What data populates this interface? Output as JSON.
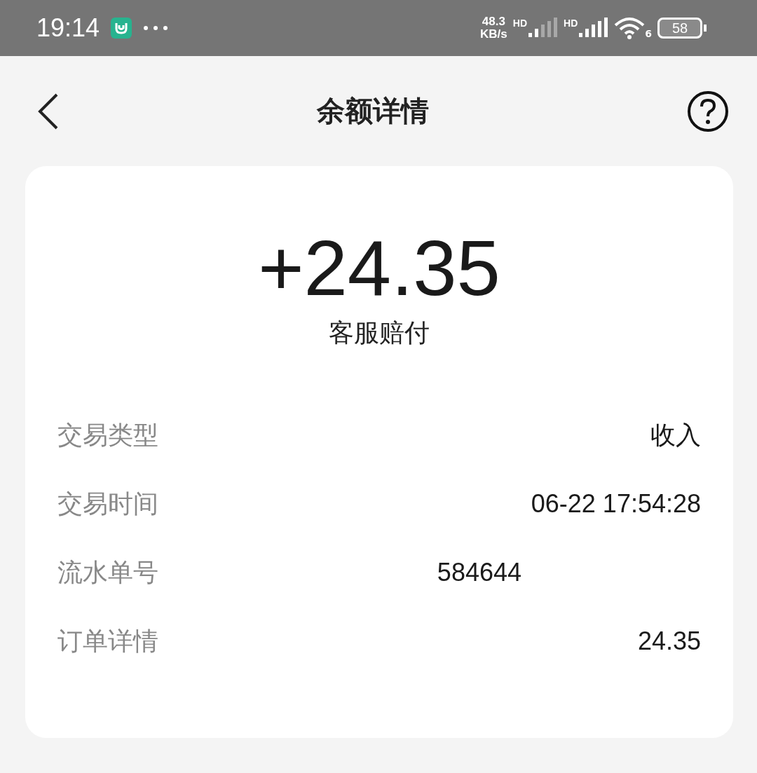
{
  "status_bar": {
    "time": "19:14",
    "speed_value": "48.3",
    "speed_unit": "KB/s",
    "sim_labels": [
      "HD",
      "HD"
    ],
    "wifi_label": "6",
    "battery": "58"
  },
  "header": {
    "title": "余额详情"
  },
  "summary": {
    "amount": "+24.35",
    "description": "客服赔付"
  },
  "details": [
    {
      "label": "交易类型",
      "value": "收入",
      "kind": "plain"
    },
    {
      "label": "交易时间",
      "value": "06-22 17:54:28",
      "kind": "plain"
    },
    {
      "label": "流水单号",
      "value": "584644",
      "kind": "masked"
    },
    {
      "label": "订单详情",
      "value": "24.35",
      "kind": "plain"
    }
  ]
}
